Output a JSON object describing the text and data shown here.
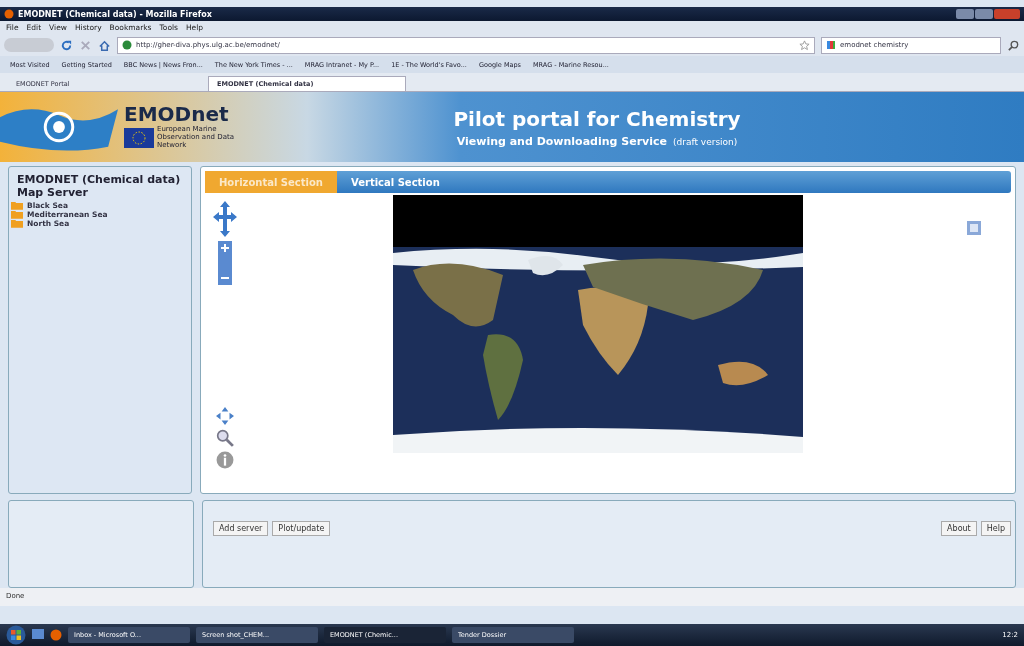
{
  "window": {
    "title": "EMODNET (Chemical data) - Mozilla Firefox"
  },
  "menu": [
    "File",
    "Edit",
    "View",
    "History",
    "Bookmarks",
    "Tools",
    "Help"
  ],
  "toolbar": {
    "url": "http://gher-diva.phys.ulg.ac.be/emodnet/",
    "search": "emodnet chemistry"
  },
  "bookmarks": [
    "Most Visited",
    "Getting Started",
    "BBC News | News Fron...",
    "The New York Times - ...",
    "MRAG Intranet - My P...",
    "1E - The World's Favo...",
    "Google Maps",
    "MRAG - Marine Resou..."
  ],
  "browser_tabs": [
    {
      "label": "EMODNET Portal",
      "selected": false
    },
    {
      "label": "EMODNET (Chemical data)",
      "selected": true
    }
  ],
  "header": {
    "logo_text": "EMODnet",
    "logo_subtitle": "European Marine Observation and Data Network",
    "title": "Pilot portal for Chemistry",
    "subtitle": "Viewing and Downloading Service",
    "note": "(draft version)"
  },
  "sidebar": {
    "title": "EMODNET (Chemical data) Map Server",
    "items": [
      {
        "label": "Black Sea"
      },
      {
        "label": "Mediterranean Sea"
      },
      {
        "label": "North Sea"
      }
    ]
  },
  "section_tabs": [
    {
      "label": "Horizontal Section",
      "selected": true
    },
    {
      "label": "Vertical Section",
      "selected": false
    }
  ],
  "buttons_left": [
    "Add server",
    "Plot/update"
  ],
  "buttons_right": [
    "About",
    "Help"
  ],
  "status": "Done",
  "taskbar": {
    "tasks": [
      {
        "label": "Inbox - Microsoft O...",
        "selected": false
      },
      {
        "label": "Screen shot_CHEM...",
        "selected": false
      },
      {
        "label": "EMODNET (Chemic...",
        "selected": true
      },
      {
        "label": "Tender Dossier",
        "selected": false
      }
    ],
    "clock": "12:2"
  }
}
